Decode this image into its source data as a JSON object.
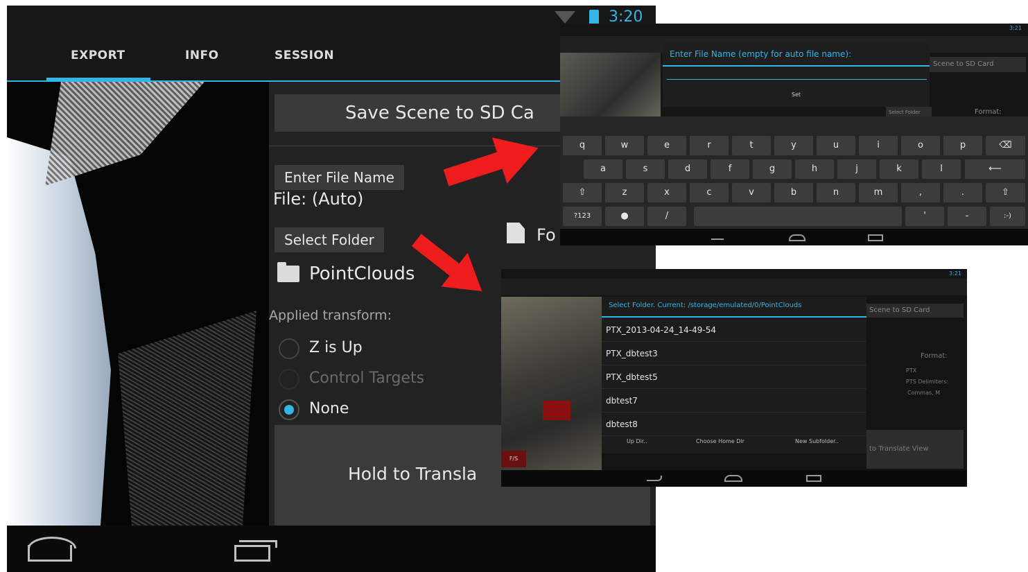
{
  "status": {
    "time": "3:20"
  },
  "tabs": [
    "EXPORT",
    "INFO",
    "SESSION"
  ],
  "export": {
    "save_button": "Save Scene to SD Ca",
    "enter_file_name_button": "Enter File Name",
    "file_label": "File: (Auto)",
    "select_folder_button": "Select Folder",
    "format_label": "Fo",
    "folder_name": "PointClouds",
    "applied_transform_label": "Applied transform:",
    "transform_options": [
      "Z is Up",
      "Control Targets",
      "None"
    ],
    "transform_selected": "None",
    "hold_to_translate": "Hold to Transla"
  },
  "file_name_dialog": {
    "title": "Enter File Name (empty for auto file name):",
    "set_button": "Set",
    "background_save_button": "Scene to SD Card",
    "background_select_folder": "Select Folder",
    "background_format": "Format:"
  },
  "keyboard": {
    "row1": [
      "q",
      "w",
      "e",
      "r",
      "t",
      "y",
      "u",
      "i",
      "o",
      "p"
    ],
    "row2": [
      "a",
      "s",
      "d",
      "f",
      "g",
      "h",
      "j",
      "k",
      "l"
    ],
    "row3": [
      "z",
      "x",
      "c",
      "v",
      "b",
      "n",
      "m",
      ",",
      "."
    ],
    "symbols_key": "?123",
    "slash_key": "/",
    "smiley_key": ":-)",
    "dash_key": "-",
    "apostrophe_key": "'"
  },
  "folder_dialog": {
    "title": "Select Folder. Current: /storage/emulated/0/PointClouds",
    "folders": [
      "PTX_2013-04-24_14-49-54",
      "PTX_dbtest3",
      "PTX_dbtest5",
      "dbtest7",
      "dbtest8"
    ],
    "buttons": [
      "Up Dir..",
      "Choose Home Dir",
      "New Subfolder.."
    ],
    "background_save_button": "Scene to SD Card",
    "background_format": "Format:",
    "background_format_value": "PTX",
    "background_delimiters": "PTS Delimiters:",
    "background_delimiter_value": "Commas, M",
    "background_translate": "to Translate View",
    "fs_label": "F/S",
    "status_time": "3:21"
  },
  "icons": [
    "wifi-icon",
    "battery-icon",
    "document-icon",
    "folder-icon",
    "home-icon",
    "recent-apps-icon",
    "back-icon",
    "backspace-icon",
    "enter-icon",
    "shift-icon",
    "mic-icon"
  ],
  "colors": {
    "accent": "#33b5e5",
    "arrow": "#ee1c1c",
    "background": "#0f0f0f"
  }
}
